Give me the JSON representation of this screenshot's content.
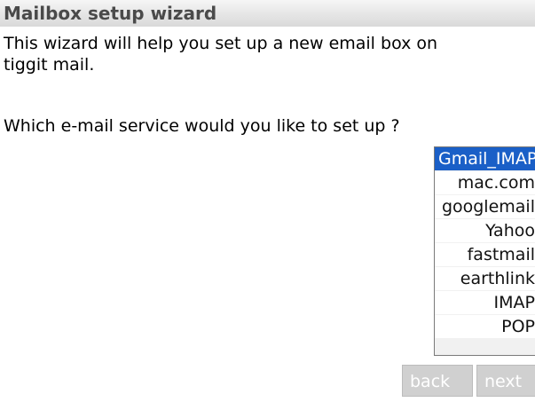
{
  "header": {
    "title": "Mailbox setup wizard"
  },
  "intro": {
    "text": "This wizard will help you set up a new email box on\ntiggit mail."
  },
  "question": {
    "text": "Which e-mail service would you like to set up ?"
  },
  "services": [
    {
      "label": "Gmail_IMAP",
      "selected": true
    },
    {
      "label": "mac.com",
      "selected": false
    },
    {
      "label": "googlemail",
      "selected": false
    },
    {
      "label": "Yahoo",
      "selected": false
    },
    {
      "label": "fastmail",
      "selected": false
    },
    {
      "label": "earthlink",
      "selected": false
    },
    {
      "label": "IMAP",
      "selected": false
    },
    {
      "label": "POP",
      "selected": false
    }
  ],
  "buttons": {
    "back_label": "back",
    "next_label": "next"
  },
  "colors": {
    "selection": "#1a5fc7",
    "button_disabled": "#d0d0d0"
  }
}
